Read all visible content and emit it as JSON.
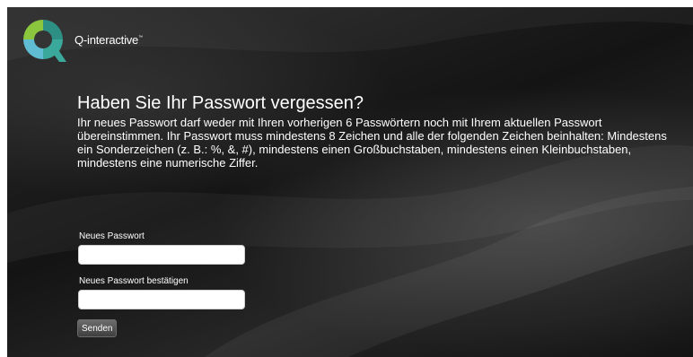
{
  "brand": {
    "name": "Q-interactive",
    "trademark": "™"
  },
  "page": {
    "title": "Haben Sie Ihr Passwort vergessen?",
    "description": "Ihr neues Passwort darf weder mit Ihren vorherigen 6 Passwörtern noch mit Ihrem aktuellen Passwort übereinstimmen. Ihr Passwort muss mindestens 8 Zeichen und alle der folgenden Zeichen beinhalten: Mindestens ein Sonderzeichen (z. B.: %, &, #), mindestens einen Großbuchstaben, mindestens einen Kleinbuchstaben, mindestens eine numerische Ziffer."
  },
  "form": {
    "new_password_label": "Neues Passwort",
    "new_password_value": "",
    "confirm_password_label": "Neues Passwort bestätigen",
    "confirm_password_value": "",
    "submit_label": "Senden"
  },
  "colors": {
    "background": "#1a1a1a",
    "logo_green": "#8cc63f",
    "logo_blue": "#5fbcd3",
    "logo_teal": "#3aa89a",
    "text": "#ffffff"
  },
  "icons": {
    "logo": "q-interactive-logo-icon"
  }
}
